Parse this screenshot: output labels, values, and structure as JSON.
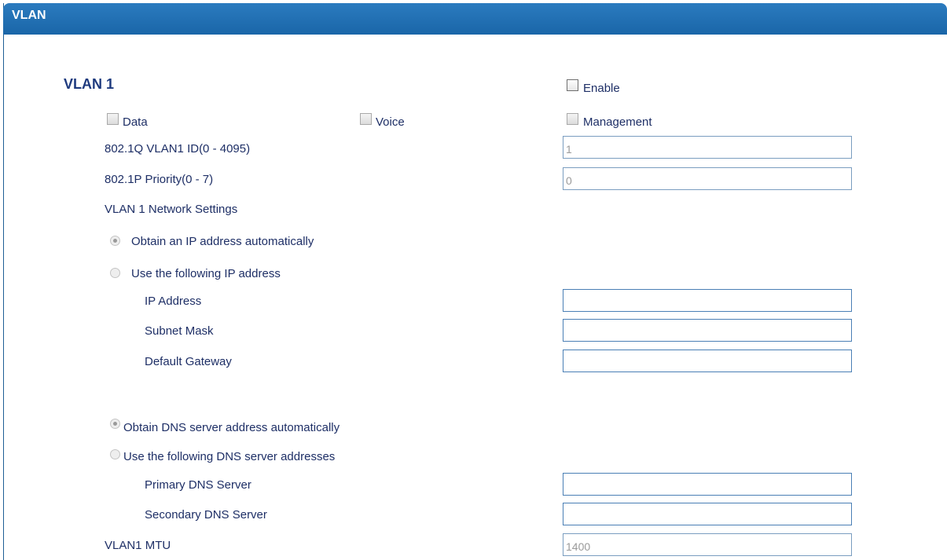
{
  "header": {
    "title": "VLAN"
  },
  "vlan": {
    "title": "VLAN 1",
    "enable": {
      "label": "Enable",
      "checked": false
    },
    "types": {
      "data": {
        "label": "Data",
        "checked": false
      },
      "voice": {
        "label": "Voice",
        "checked": false
      },
      "management": {
        "label": "Management",
        "checked": false
      }
    },
    "vlan_id": {
      "label": "802.1Q VLAN1 ID(0 - 4095)",
      "value": "1"
    },
    "priority": {
      "label": "802.1P Priority(0 - 7)",
      "value": "0"
    },
    "network_settings_label": "VLAN 1 Network Settings",
    "ip_mode": {
      "auto_label": "Obtain an IP address automatically",
      "manual_label": "Use the following IP address",
      "selected": "auto"
    },
    "ip_address": {
      "label": "IP Address",
      "value": ""
    },
    "subnet_mask": {
      "label": "Subnet Mask",
      "value": ""
    },
    "default_gateway": {
      "label": "Default Gateway",
      "value": ""
    },
    "dns_mode": {
      "auto_label": "Obtain DNS server address automatically",
      "manual_label": "Use the following DNS server addresses",
      "selected": "auto"
    },
    "primary_dns": {
      "label": "Primary DNS Server",
      "value": ""
    },
    "secondary_dns": {
      "label": "Secondary DNS Server",
      "value": ""
    },
    "mtu": {
      "label": "VLAN1 MTU",
      "value": "1400"
    }
  }
}
